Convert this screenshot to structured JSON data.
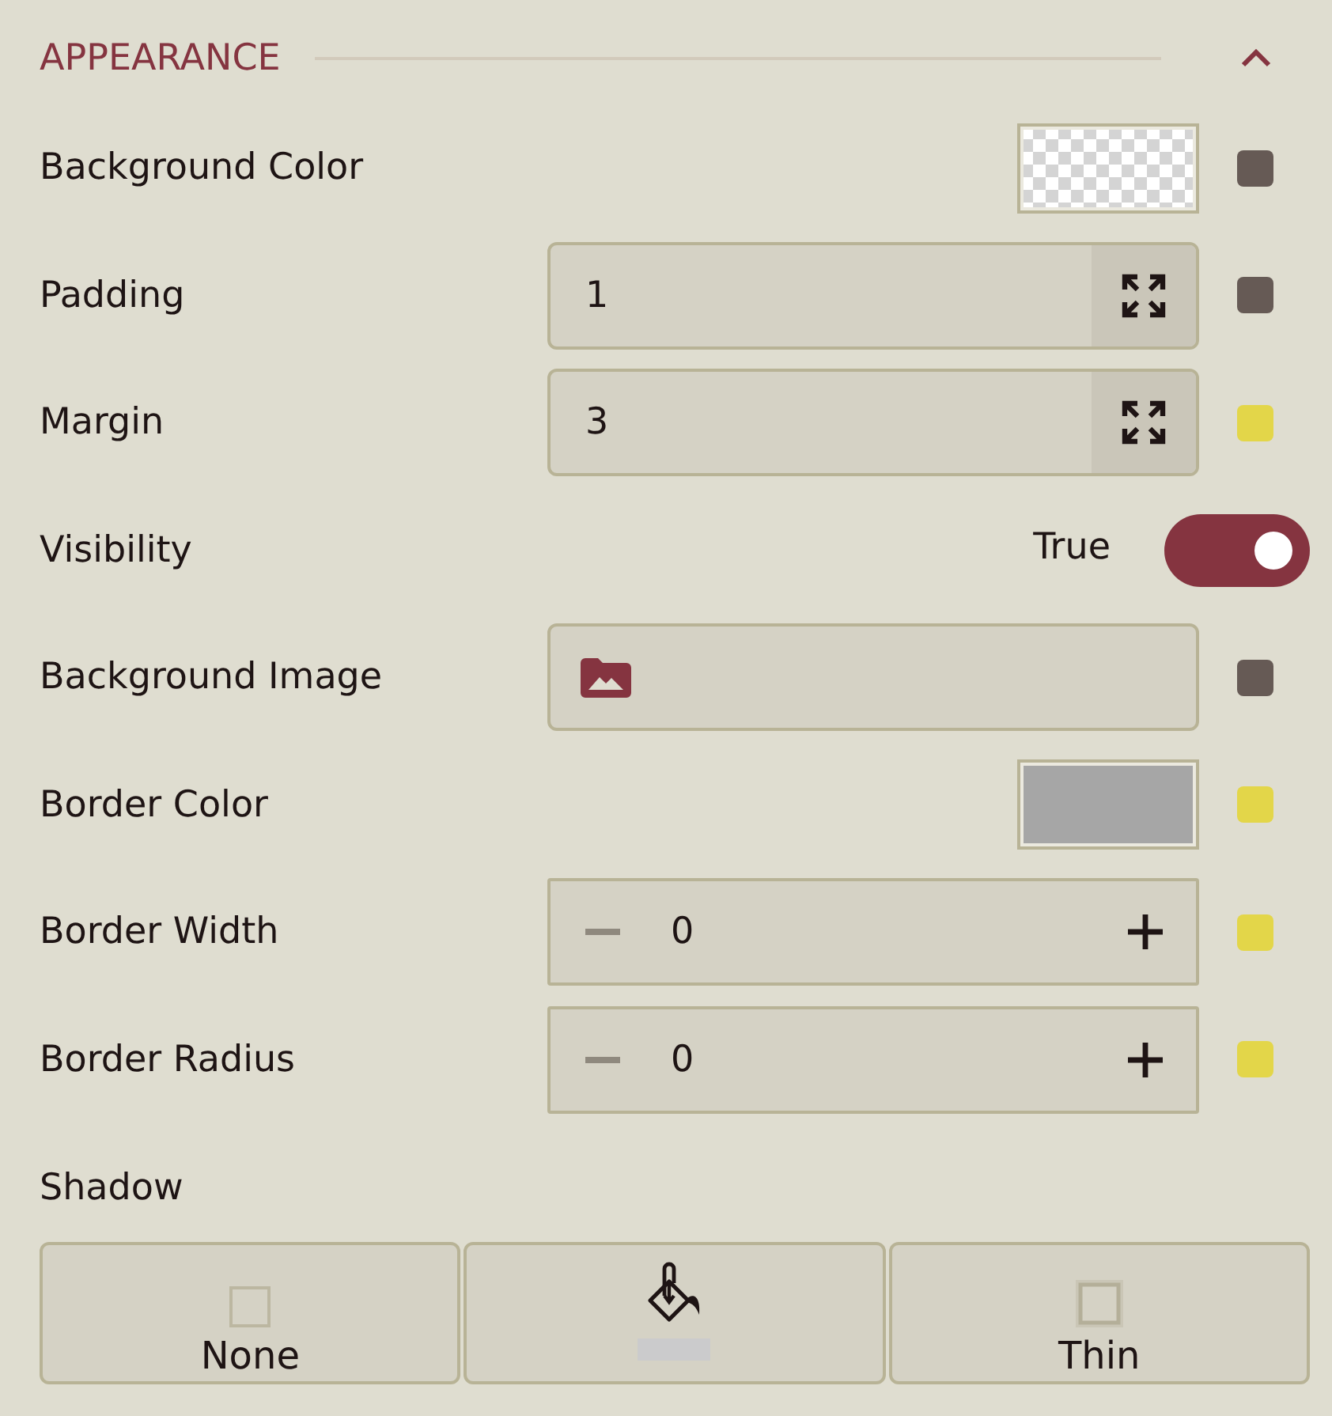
{
  "section": {
    "title": "APPEARANCE",
    "expanded": true
  },
  "properties": [
    {
      "kind": "color",
      "label": "Background Color",
      "swatch": {
        "transparent": true
      },
      "indicator": {
        "color": "#665a55"
      }
    },
    {
      "kind": "dimension",
      "label": "Padding",
      "value": "1",
      "indicator": {
        "color": "#665a55"
      }
    },
    {
      "kind": "dimension",
      "label": "Margin",
      "value": "3",
      "indicator": {
        "color": "#e3d649"
      }
    },
    {
      "kind": "toggle",
      "label": "Visibility",
      "state_label": "True",
      "on": true
    },
    {
      "kind": "image",
      "label": "Background Image",
      "indicator": {
        "color": "#665a55"
      }
    },
    {
      "kind": "color",
      "label": "Border Color",
      "swatch": {
        "transparent": false,
        "color": "#a6a6a6"
      },
      "indicator": {
        "color": "#e3d649"
      }
    },
    {
      "kind": "stepper",
      "label": "Border Width",
      "value": "0",
      "decrement_disabled": true,
      "indicator": {
        "color": "#e3d649"
      }
    },
    {
      "kind": "stepper",
      "label": "Border Radius",
      "value": "0",
      "decrement_disabled": true,
      "indicator": {
        "color": "#e3d649"
      }
    }
  ],
  "shadow": {
    "label": "Shadow",
    "options": [
      {
        "kind": "none",
        "label": "None"
      },
      {
        "kind": "color",
        "swatch": {
          "color": "#cbcbcc"
        }
      },
      {
        "kind": "thin",
        "label": "Thin"
      }
    ]
  }
}
